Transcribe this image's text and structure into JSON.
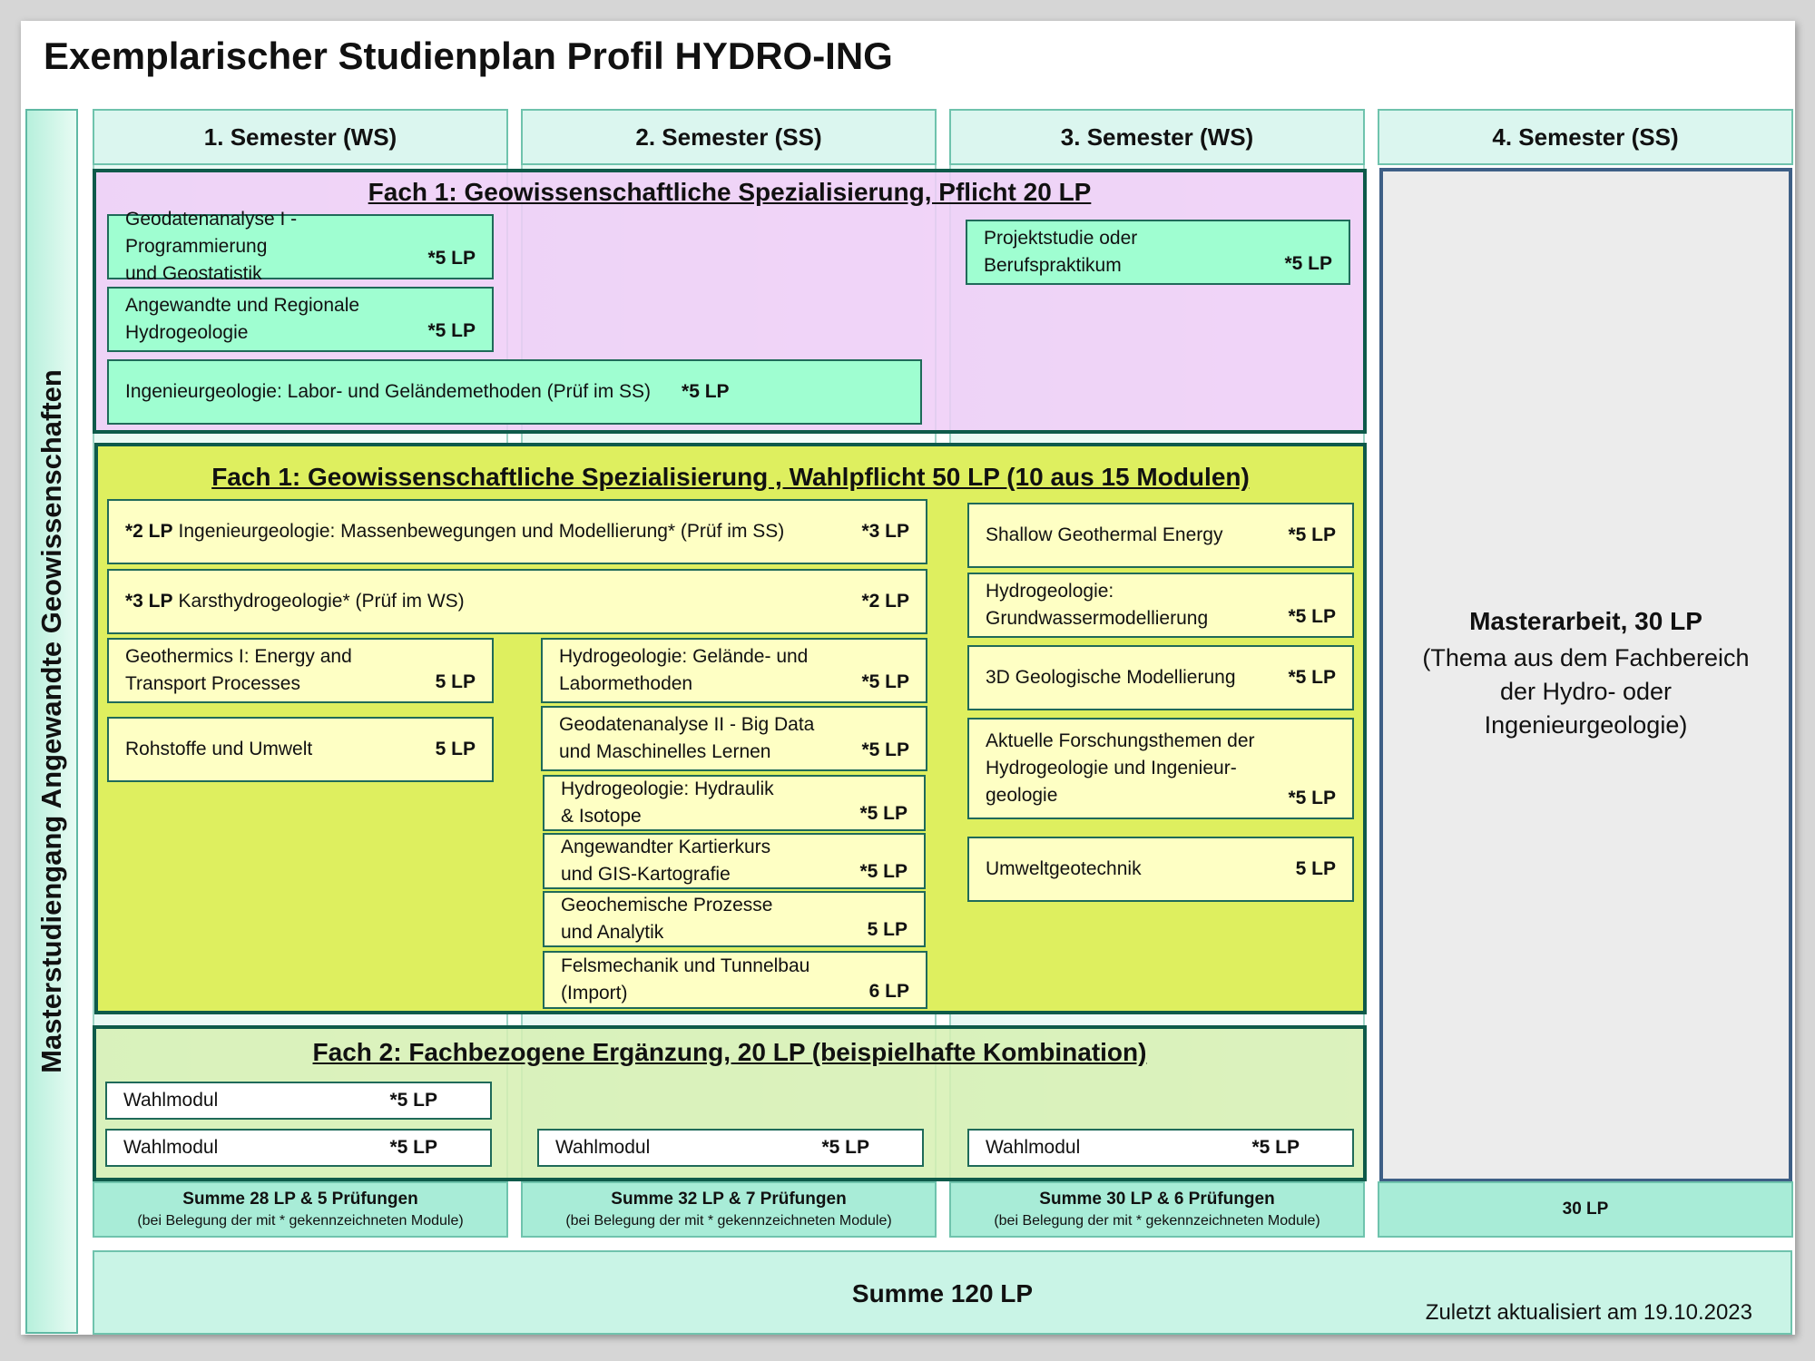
{
  "title": "Exemplarischer Studienplan Profil HYDRO-ING",
  "side_label": "Masterstudiengang Angewandte Geowissenschaften",
  "semesters": [
    {
      "label": "1. Semester (WS)",
      "sum": "Summe 28 LP & 5 Prüfungen",
      "sum_note": "(bei Belegung der mit * gekennzeichneten Module)"
    },
    {
      "label": "2. Semester (SS)",
      "sum": "Summe 32 LP & 7 Prüfungen",
      "sum_note": "(bei Belegung der mit * gekennzeichneten Module)"
    },
    {
      "label": "3. Semester (WS)",
      "sum": "Summe 30 LP & 6 Prüfungen",
      "sum_note": "(bei Belegung der mit * gekennzeichneten Module)"
    },
    {
      "label": "4. Semester (SS)",
      "sum": "30 LP",
      "sum_note": ""
    }
  ],
  "pflicht": {
    "title": "Fach 1: Geowissenschaftliche Spezialisierung, Pflicht 20 LP",
    "modules": [
      {
        "name": "Geodatenanalyse I - Programmierung\nund Geostatistik",
        "lp": "*5 LP"
      },
      {
        "name": "Angewandte und Regionale\nHydrogeologie",
        "lp": "*5 LP"
      },
      {
        "name": "Ingenieurgeologie: Labor- und Geländemethoden (Prüf im SS)",
        "lp": "*5 LP"
      },
      {
        "name": "Projektstudie oder\nBerufspraktikum",
        "lp": "*5 LP"
      }
    ]
  },
  "wahlpflicht": {
    "title": "Fach 1: Geowissenschaftliche Spezialisierung , Wahlpflicht 50 LP (10 aus 15 Modulen)",
    "modules": [
      {
        "pre": "*2 LP",
        "name": "Ingenieurgeologie: Massenbewegungen und Modellierung*  (Prüf im SS)",
        "lp": "*3 LP"
      },
      {
        "pre": "*3 LP",
        "name": "Karsthydrogeologie*  (Prüf im WS)",
        "lp": "*2 LP"
      },
      {
        "name": "Geothermics I: Energy and\nTransport Processes",
        "lp": "5 LP"
      },
      {
        "name": "Rohstoffe und Umwelt",
        "lp": "5 LP"
      },
      {
        "name": "Hydrogeologie: Gelände- und\nLabormethoden",
        "lp": "*5 LP"
      },
      {
        "name": "Geodatenanalyse II - Big Data\nund Maschinelles Lernen",
        "lp": "*5 LP"
      },
      {
        "name": "Hydrogeologie: Hydraulik\n& Isotope",
        "lp": "*5 LP"
      },
      {
        "name": "Angewandter Kartierkurs\nund GIS-Kartografie",
        "lp": "*5 LP"
      },
      {
        "name": "Geochemische Prozesse\nund Analytik",
        "lp": "5 LP"
      },
      {
        "name": "Felsmechanik und Tunnelbau\n(Import)",
        "lp": "6 LP"
      },
      {
        "name": "Shallow Geothermal Energy",
        "lp": "*5 LP"
      },
      {
        "name": "Hydrogeologie:\nGrundwassermodellierung",
        "lp": "*5 LP"
      },
      {
        "name": "3D Geologische Modellierung",
        "lp": "*5 LP"
      },
      {
        "name": "Aktuelle Forschungsthemen der\nHydrogeologie und Ingenieur-\ngeologie",
        "lp": "*5 LP"
      },
      {
        "name": "Umweltgeotechnik",
        "lp": "5 LP"
      }
    ]
  },
  "fach2": {
    "title": "Fach 2: Fachbezogene Ergänzung, 20 LP (beispielhafte Kombination)",
    "modules": [
      {
        "name": "Wahlmodul",
        "lp": "*5 LP"
      },
      {
        "name": "Wahlmodul",
        "lp": "*5 LP"
      },
      {
        "name": "Wahlmodul",
        "lp": "*5 LP"
      },
      {
        "name": "Wahlmodul",
        "lp": "*5 LP"
      }
    ]
  },
  "thesis": {
    "title": "Masterarbeit, 30 LP",
    "subtitle": "(Thema aus dem Fachbereich\nder Hydro- oder\nIngenieurgeologie)"
  },
  "total": "Summe 120 LP",
  "updated": "Zuletzt  aktualisiert am 19.10.2023"
}
